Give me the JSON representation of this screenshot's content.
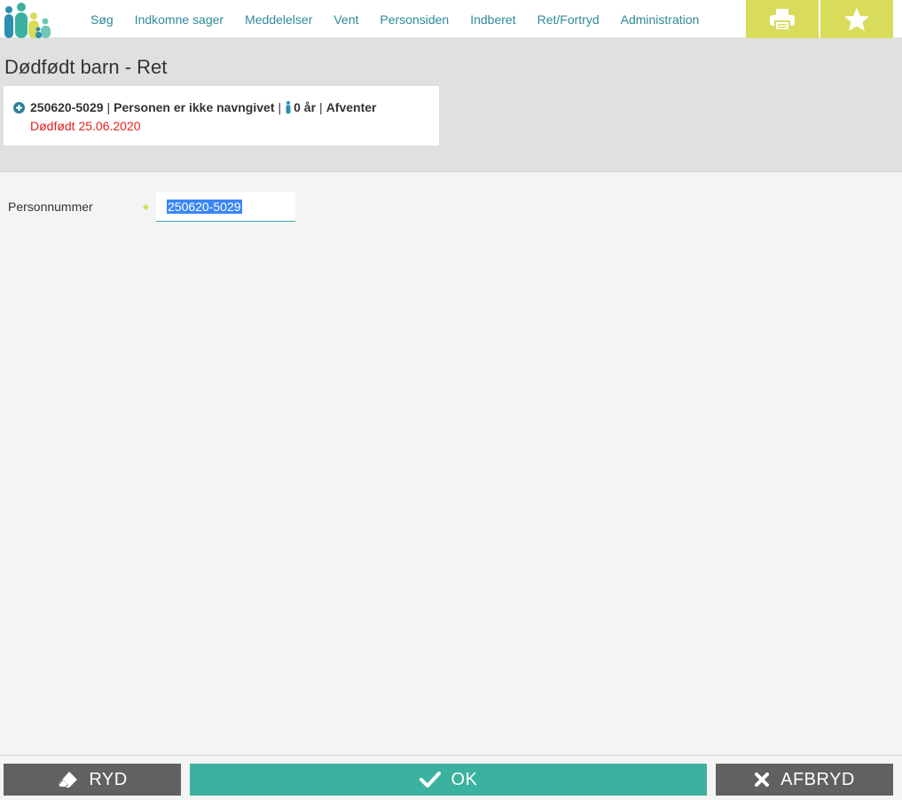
{
  "nav": {
    "items": [
      {
        "label": "Søg"
      },
      {
        "label": "Indkomne sager"
      },
      {
        "label": "Meddelelser"
      },
      {
        "label": "Vent"
      },
      {
        "label": "Personsiden"
      },
      {
        "label": "Indberet"
      },
      {
        "label": "Ret/Fortryd"
      },
      {
        "label": "Administration"
      }
    ],
    "tools": [
      "print-icon",
      "star-icon"
    ],
    "accent_color": "#d9dc5a",
    "link_color": "#2d8a99"
  },
  "page": {
    "title": "Dødfødt barn - Ret"
  },
  "person": {
    "cpr": "250620-5029",
    "name": "Personen er ikke navngivet",
    "age": "0 år",
    "status": "Afventer",
    "death_note": "Dødfødt 25.06.2020",
    "death_color": "#e8201f"
  },
  "form": {
    "fields": [
      {
        "label": "Personnummer",
        "value": "250620-5029",
        "required": true
      }
    ]
  },
  "footer": {
    "clear_label": "RYD",
    "ok_label": "OK",
    "cancel_label": "AFBRYD",
    "ok_color": "#3bb29f",
    "secondary_color": "#616161"
  }
}
